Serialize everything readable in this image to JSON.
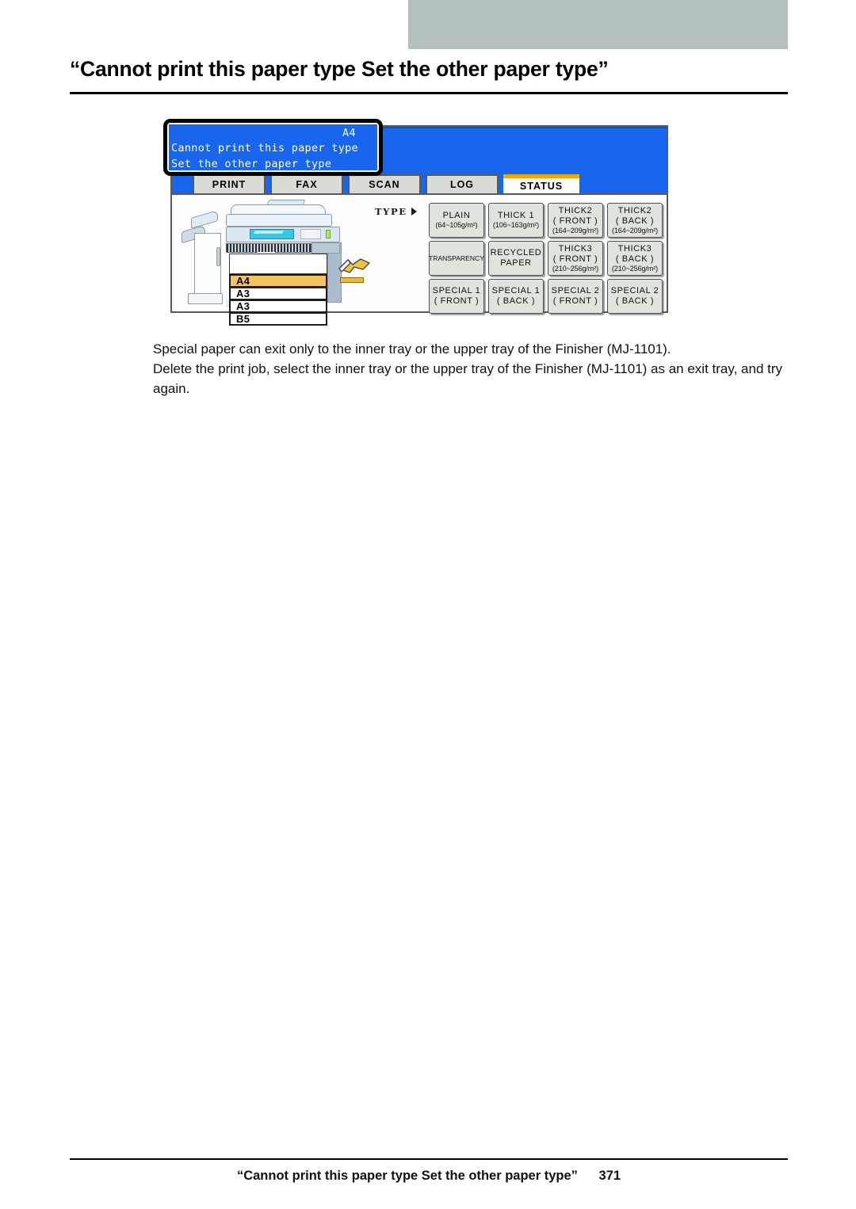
{
  "page": {
    "title": "“Cannot print this paper type  Set the other paper type”",
    "footer_title": "“Cannot print this paper type Set the other paper type”",
    "footer_page": "371"
  },
  "colors": {
    "top_bar": "#b4bfbf",
    "lcd_blue": "#1866ee",
    "active_tab_accent": "#f0a800",
    "selected_tray": "#f6c363",
    "button_face": "#dfe4dc"
  },
  "lcd": {
    "message": {
      "paper_size": "A4",
      "line1": "Cannot print this paper type",
      "line2": "Set the other paper type"
    },
    "tabs": [
      {
        "label": "PRINT",
        "active": false
      },
      {
        "label": "FAX",
        "active": false
      },
      {
        "label": "SCAN",
        "active": false
      },
      {
        "label": "LOG",
        "active": false
      },
      {
        "label": "STATUS",
        "active": true
      }
    ],
    "type_label": "TYPE",
    "trays": [
      {
        "label": "A4",
        "selected": true
      },
      {
        "label": "A3",
        "selected": false
      },
      {
        "label": "A3",
        "selected": false
      },
      {
        "label": "B5",
        "selected": false
      }
    ],
    "paper_types": [
      {
        "l1": "PLAIN",
        "l2": "",
        "l3": "(64~105g/m²)"
      },
      {
        "l1": "THICK 1",
        "l2": "",
        "l3": "(106~163g/m²)"
      },
      {
        "l1": "THICK2",
        "l2": "( FRONT )",
        "l3": "(164~209g/m²)"
      },
      {
        "l1": "THICK2",
        "l2": "( BACK )",
        "l3": "(164~209g/m²)"
      },
      {
        "l1": "TRANSPARENCY",
        "l2": "",
        "l3": ""
      },
      {
        "l1": "RECYCLED",
        "l2": "PAPER",
        "l3": ""
      },
      {
        "l1": "THICK3",
        "l2": "( FRONT )",
        "l3": "(210~256g/m²)"
      },
      {
        "l1": "THICK3",
        "l2": "( BACK )",
        "l3": "(210~256g/m²)"
      },
      {
        "l1": "SPECIAL 1",
        "l2": "( FRONT )",
        "l3": ""
      },
      {
        "l1": "SPECIAL 1",
        "l2": "( BACK )",
        "l3": ""
      },
      {
        "l1": "SPECIAL 2",
        "l2": "( FRONT )",
        "l3": ""
      },
      {
        "l1": "SPECIAL 2",
        "l2": "( BACK )",
        "l3": ""
      }
    ]
  },
  "body": {
    "paragraph1": "Special paper can exit only to the inner tray or the upper tray of the Finisher (MJ-1101).",
    "paragraph2": "Delete the print job, select the inner tray or the upper tray of the Finisher (MJ-1101) as an exit tray, and try again."
  }
}
